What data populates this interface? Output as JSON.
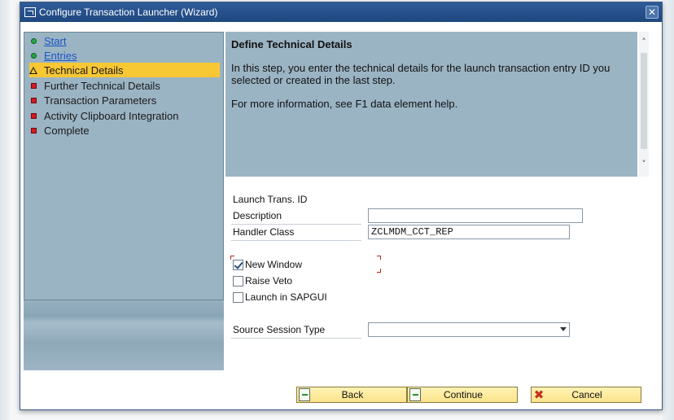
{
  "window": {
    "title": "Configure Transaction Launcher (Wizard)",
    "close_glyph": "✕"
  },
  "steps": [
    {
      "label": "Start",
      "status": "done",
      "link": true
    },
    {
      "label": "Entries",
      "status": "done",
      "link": true
    },
    {
      "label": "Technical Details",
      "status": "current",
      "link": false
    },
    {
      "label": "Further Technical Details",
      "status": "pending",
      "link": false
    },
    {
      "label": "Transaction Parameters",
      "status": "pending",
      "link": false
    },
    {
      "label": "Activity Clipboard Integration",
      "status": "pending",
      "link": false
    },
    {
      "label": "Complete",
      "status": "pending",
      "link": false
    }
  ],
  "info": {
    "title": "Define Technical Details",
    "text": "In this step, you enter the technical details for the launch transaction entry ID you selected or created in the last step.",
    "more": "For more information, see F1 data element help."
  },
  "form": {
    "launch_id_label": "Launch Trans. ID",
    "description_label": "Description",
    "description_value": "",
    "handler_class_label": "Handler Class",
    "handler_class_value": "ZCLMDM_CCT_REP",
    "new_window_label": "New Window",
    "new_window_checked": true,
    "raise_veto_label": "Raise Veto",
    "raise_veto_checked": false,
    "launch_sapgui_label": "Launch in SAPGUI",
    "launch_sapgui_checked": false,
    "source_session_type_label": "Source Session Type",
    "source_session_type_value": ""
  },
  "buttons": {
    "back": "Back",
    "continue": "Continue",
    "cancel": "Cancel"
  },
  "colors": {
    "titlebar": "#2f5b99",
    "panel": "#9bb4c4",
    "active_step": "#f8c734",
    "button": "#fbe38a"
  },
  "icons": {
    "step_done": "green-dot-icon",
    "step_current": "warning-triangle-icon",
    "step_pending": "red-square-icon"
  }
}
